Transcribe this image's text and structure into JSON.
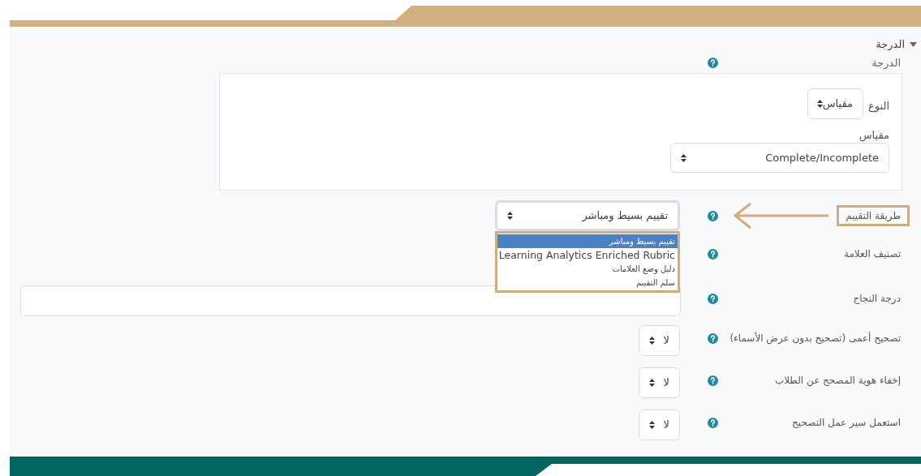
{
  "section": {
    "title": "الدرجة",
    "expanded": true
  },
  "grade": {
    "label": "الدرجة",
    "type_label": "النوع",
    "type_value": "مقياس",
    "scale_label": "مقياس",
    "scale_value": "Complete/Incomplete"
  },
  "fields": [
    {
      "kind": "method",
      "label": "طريقة التقييم",
      "value": "تقييم بسيط ومباشر",
      "highlighted": true,
      "options": [
        {
          "label": "تقييم بسيط ومباشر",
          "selected": true
        },
        {
          "label": "Learning Analytics Enriched Rubric",
          "selected": false
        },
        {
          "label": "دليل وضع العلامات",
          "selected": false
        },
        {
          "label": "سلم التقييم",
          "selected": false
        }
      ]
    },
    {
      "kind": "plain",
      "label": "تصنيف العلامة"
    },
    {
      "kind": "text",
      "label": "درجة النجاح"
    },
    {
      "kind": "select",
      "label": "تصحيح أعمى (تصحيح بدون عرض الأسماء)",
      "value": "لا"
    },
    {
      "kind": "select",
      "label": "إخفاء هوية المصحح عن الطلاب",
      "value": "لا"
    },
    {
      "kind": "select",
      "label": "استعمل سير عمل التصحيح",
      "value": "لا"
    }
  ]
}
